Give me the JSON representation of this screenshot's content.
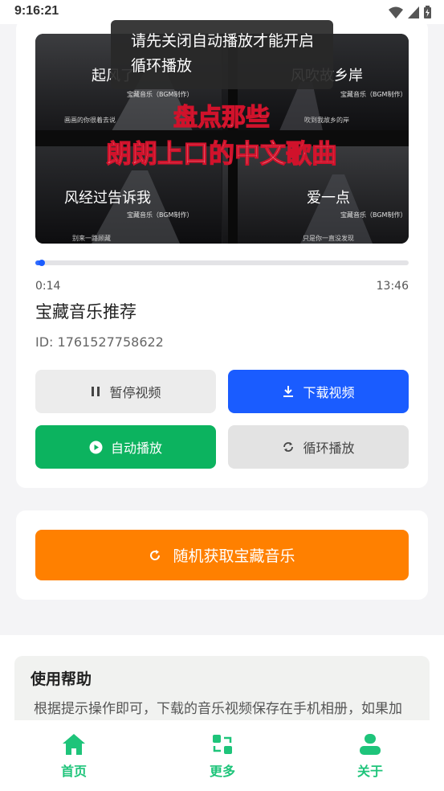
{
  "status_bar": {
    "time": "9:16:21"
  },
  "toast": {
    "text": "请先关闭自动播放才能开启循环播放"
  },
  "video": {
    "overlay_text_top_left": "起风了",
    "overlay_text_top_right": "风吹故乡岸",
    "overlay_title_line1": "盘点那些",
    "overlay_title_line2": "朗朗上口的中文歌曲",
    "overlay_text_bottom_left": "风经过告诉我",
    "overlay_text_bottom_right": "爱一点",
    "caption_tl": "宝藏音乐（BGM制作）",
    "caption_tr": "宝藏音乐（BGM制作）",
    "caption_bl": "宝藏音乐（BGM制作）",
    "caption_br": "宝藏音乐（BGM制作）",
    "subline_tl": "画画的你很着去说",
    "subline_tr": "吹到我故乡的岸",
    "subline_bl": "别来一路顾藏",
    "subline_br": "只是你一直没发现"
  },
  "player": {
    "progress_fraction": 0.017,
    "current_time": "0:14",
    "total_time": "13:46",
    "title": "宝藏音乐推荐",
    "id_text": "ID: 1761527758622",
    "pause_label": "暂停视频",
    "download_label": "下载视频",
    "autoplay_label": "自动播放",
    "loop_label": "循环播放"
  },
  "random": {
    "label": "随机获取宝藏音乐"
  },
  "help": {
    "title": "使用帮助",
    "text": "根据提示操作即可，下载的音乐视频保存在手机相册，如果加载不出来请尝试重新获取视频或更换网络。"
  },
  "nav": {
    "home": "首页",
    "more": "更多",
    "about": "关于"
  },
  "colors": {
    "accent_blue": "#1a5cff",
    "accent_green": "#0cb35f",
    "accent_orange": "#ff8000",
    "nav_green": "#1ec47a"
  },
  "icons": {
    "pause": "pause-icon",
    "download": "download-icon",
    "autoplay": "play-circle-icon",
    "loop": "loop-icon",
    "random": "refresh-icon",
    "home": "home-icon",
    "more": "swap-icon",
    "about": "user-icon"
  }
}
